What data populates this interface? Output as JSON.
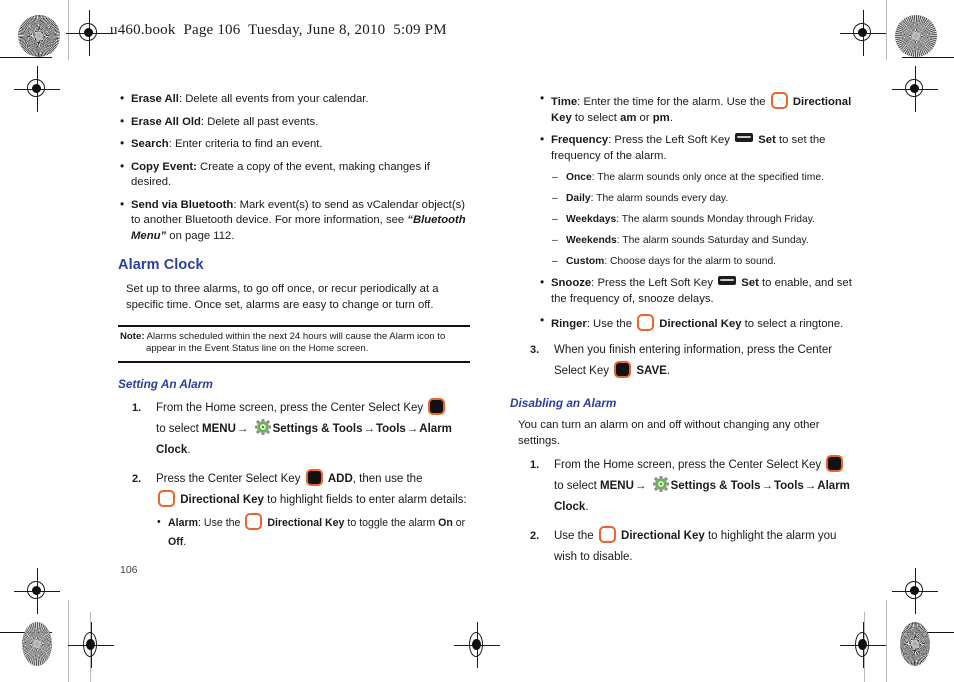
{
  "document": {
    "header": "u460.book  Page 106  Tuesday, June 8, 2010  5:09 PM",
    "page_number": "106",
    "accent_heading_color": "#2b3f9e",
    "key_border_color": "#e8662a"
  },
  "left_column": {
    "calendar_options": [
      {
        "term": "Erase All",
        "sep": ": ",
        "desc": "Delete all events from your calendar."
      },
      {
        "term": "Erase All Old",
        "sep": ": ",
        "desc": "Delete all past events."
      },
      {
        "term": "Search",
        "sep": ": ",
        "desc": "Enter criteria to find an event."
      },
      {
        "term": "Copy Event:",
        "sep": " ",
        "desc": "Create a copy of the event, making changes if desired."
      }
    ],
    "bluetooth_item": {
      "term": "Send via Bluetooth",
      "desc_part1": ": Mark event(s) to send as vCalendar object(s) to another Bluetooth device.  For more information, see ",
      "reference": "“Bluetooth Menu”",
      "desc_part2": " on page 112."
    },
    "alarm_clock_heading": "Alarm Clock",
    "alarm_clock_intro": "Set up to three alarms, to go off once, or recur periodically at a specific time. Once set, alarms are easy to change or turn off.",
    "note": {
      "label": "Note:",
      "text": " Alarms scheduled within the next 24 hours will cause the Alarm icon to appear in the Event Status line on the Home screen."
    },
    "setting_alarm_heading": "Setting An Alarm",
    "step1": {
      "number": "1.",
      "text_a": "From the Home screen, press the Center Select Key ",
      "center_key_icon": "center-select-key-icon",
      "text_b": "to select ",
      "menu": "MENU",
      "arrow": "→",
      "gear_icon": "settings-tools-gear-icon",
      "settings_tools": "Settings & Tools",
      "tools": "Tools",
      "alarm_clock": "Alarm Clock",
      "period": "."
    },
    "step2": {
      "number": "2.",
      "text_a": "Press the Center Select Key ",
      "center_key_icon": "center-select-key-icon",
      "add": "ADD",
      "text_b": ", then use the ",
      "dir_key_icon": "directional-key-icon",
      "directional_key": "Directional Key",
      "text_c": " to highlight fields to enter alarm details:",
      "alarm_bullet": {
        "term": "Alarm",
        "text_a": ": Use the ",
        "dir_key_icon": "directional-key-icon",
        "directional_key": "Directional Key",
        "text_b": " to toggle the alarm ",
        "on": "On",
        "or": " or ",
        "off": "Off",
        "period": "."
      }
    }
  },
  "right_column": {
    "time_item": {
      "term": "Time",
      "text_a": ": Enter the time for the alarm. Use the ",
      "dir_key_icon": "directional-key-icon",
      "directional_key": "Directional Key",
      "text_b": " to select ",
      "am": "am",
      "or": " or ",
      "pm": "pm",
      "period": "."
    },
    "frequency_item": {
      "term": "Frequency",
      "text_a": ": Press the Left Soft Key ",
      "soft_key_icon": "left-soft-key-icon",
      "set": "Set",
      "text_b": " to set the frequency of the alarm."
    },
    "frequency_options": [
      {
        "term": "Once",
        "desc": ": The alarm sounds only once at the specified time."
      },
      {
        "term": "Daily",
        "desc": ": The alarm sounds every day."
      },
      {
        "term": "Weekdays",
        "desc": ": The alarm sounds Monday through Friday."
      },
      {
        "term": "Weekends",
        "desc": ": The alarm sounds Saturday and Sunday."
      },
      {
        "term": "Custom",
        "desc": ": Choose days for the alarm to sound."
      }
    ],
    "snooze_item": {
      "term": "Snooze",
      "text_a": ": Press the Left Soft Key ",
      "soft_key_icon": "left-soft-key-icon",
      "set": "Set",
      "text_b": " to enable, and set the frequency of, snooze delays."
    },
    "ringer_item": {
      "term": "Ringer",
      "text_a": ": Use the ",
      "dir_key_icon": "directional-key-icon",
      "directional_key": "Directional Key",
      "text_b": " to select a ringtone."
    },
    "step3": {
      "number": "3.",
      "text_a": "When you finish entering information, press the Center Select Key ",
      "center_key_icon": "center-select-key-icon",
      "save": "SAVE",
      "period": "."
    },
    "disabling_heading": "Disabling an Alarm",
    "disabling_intro": "You can turn an alarm on and off without changing any other settings.",
    "step1": {
      "number": "1.",
      "text_a": "From the Home screen, press the Center Select Key ",
      "center_key_icon": "center-select-key-icon",
      "text_b": "to select ",
      "menu": "MENU",
      "arrow": "→",
      "gear_icon": "settings-tools-gear-icon",
      "settings_tools": "Settings & Tools",
      "tools": "Tools",
      "alarm_clock": "Alarm Clock",
      "period": "."
    },
    "step2": {
      "number": "2.",
      "text_a": "Use the ",
      "dir_key_icon": "directional-key-icon",
      "directional_key": "Directional Key",
      "text_b": " to highlight the alarm you wish to disable."
    }
  }
}
